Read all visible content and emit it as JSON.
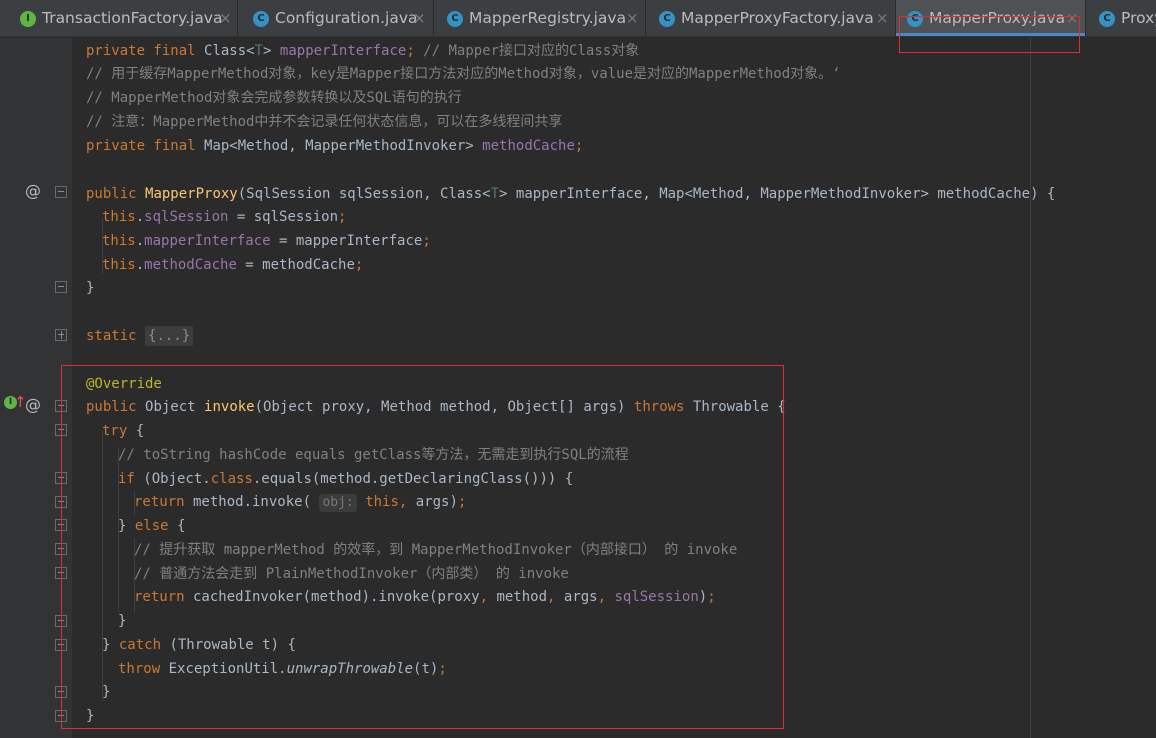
{
  "tabs": [
    {
      "label": "TransactionFactory.java",
      "icon": "interface-icon",
      "icon_letter": "I",
      "active": false
    },
    {
      "label": "Configuration.java",
      "icon": "class-icon",
      "icon_letter": "C",
      "active": false
    },
    {
      "label": "MapperRegistry.java",
      "icon": "class-icon",
      "icon_letter": "C",
      "active": false
    },
    {
      "label": "MapperProxyFactory.java",
      "icon": "class-icon",
      "icon_letter": "C",
      "active": false
    },
    {
      "label": "MapperProxy.java",
      "icon": "class-icon",
      "icon_letter": "C",
      "active": true
    },
    {
      "label": "Proxy",
      "icon": "class-icon",
      "icon_letter": "C",
      "active": false
    }
  ],
  "close_glyph": "×",
  "gutter": {
    "override_marker": "@",
    "implements_marker": "↑@"
  },
  "code": {
    "l1": {
      "kw": "private final ",
      "type": "Class",
      "lt": "<",
      "tparam": "T",
      "gt": "> ",
      "field": "mapperInterface",
      "semi": "; ",
      "comment": "// Mapper接口对应的Class对象"
    },
    "l2": "// 用于缓存MapperMethod对象，key是Mapper接口方法对应的Method对象，value是对应的MapperMethod对象。‘",
    "l3": "// MapperMethod对象会完成参数转换以及SQL语句的执行",
    "l4": "// 注意：MapperMethod中并不会记录任何状态信息，可以在多线程间共享",
    "l5": {
      "kw": "private final ",
      "type": "Map<Method, MapperMethodInvoker> ",
      "field": "methodCache",
      "semi": ";"
    },
    "l7": {
      "kw": "public ",
      "name": "MapperProxy",
      "p1": "(SqlSession sqlSession, Class",
      "lt": "<",
      "tparam": "T",
      "gt": ">",
      "p2": " mapperInterface, Map<Method, MapperMethodInvoker> methodCache) {"
    },
    "l8": {
      "this": "this",
      "dot": ".",
      "field": "sqlSession",
      "rest": " = sqlSession",
      "semi": ";"
    },
    "l9": {
      "this": "this",
      "dot": ".",
      "field": "mapperInterface",
      "rest": " = mapperInterface",
      "semi": ";"
    },
    "l10": {
      "this": "this",
      "dot": ".",
      "field": "methodCache",
      "rest": " = methodCache",
      "semi": ";"
    },
    "l11": "}",
    "l13": {
      "kw": "static ",
      "folded": "{...}"
    },
    "l15": "@Override",
    "l16": {
      "kw": "public ",
      "t1": "Object ",
      "name": "invoke",
      "p1": "(Object proxy, Method method, Object[] args) ",
      "throws": "throws",
      "p2": " Throwable {"
    },
    "l17": {
      "kw": "try",
      "rest": " {"
    },
    "l18": "// toString hashCode equals getClass等方法，无需走到执行SQL的流程",
    "l19": {
      "kw": "if",
      "p1": " (Object.",
      "kw2": "class",
      "p2": ".equals(method.getDeclaringClass())) {"
    },
    "l20": {
      "kw": "return",
      "p1": " method.invoke( ",
      "hint": "obj:",
      "this": "this",
      "comma": ", ",
      "p2": "args)",
      "semi": ";"
    },
    "l21": {
      "p1": "} ",
      "kw": "else",
      "p2": " {"
    },
    "l22": "// 提升获取 mapperMethod 的效率，到 MapperMethodInvoker（内部接口） 的 invoke",
    "l23": "// 普通方法会走到 PlainMethodInvoker（内部类） 的 invoke",
    "l24": {
      "kw": "return",
      "p1": " cachedInvoker(method).invoke(proxy",
      "c1": ", ",
      "a1": "method",
      "c2": ", ",
      "a2": "args",
      "c3": ", ",
      "field": "sqlSession",
      "p2": ")",
      "semi": ";"
    },
    "l25": "}",
    "l26": {
      "p1": "} ",
      "kw": "catch",
      "p2": " (Throwable t) {"
    },
    "l27": {
      "kw": "throw",
      "p1": " ExceptionUtil.",
      "method": "unwrapThrowable",
      "p2": "(t)",
      "semi": ";"
    },
    "l28": "}",
    "l29": "}"
  },
  "colors": {
    "background": "#2b2b2b",
    "keyword": "#cc7832",
    "field": "#9876aa",
    "comment": "#808080",
    "method_decl": "#ffc66d",
    "annotation": "#bbb529",
    "highlight_box": "#e02d2d",
    "active_tab_underline": "#4a88c7"
  }
}
